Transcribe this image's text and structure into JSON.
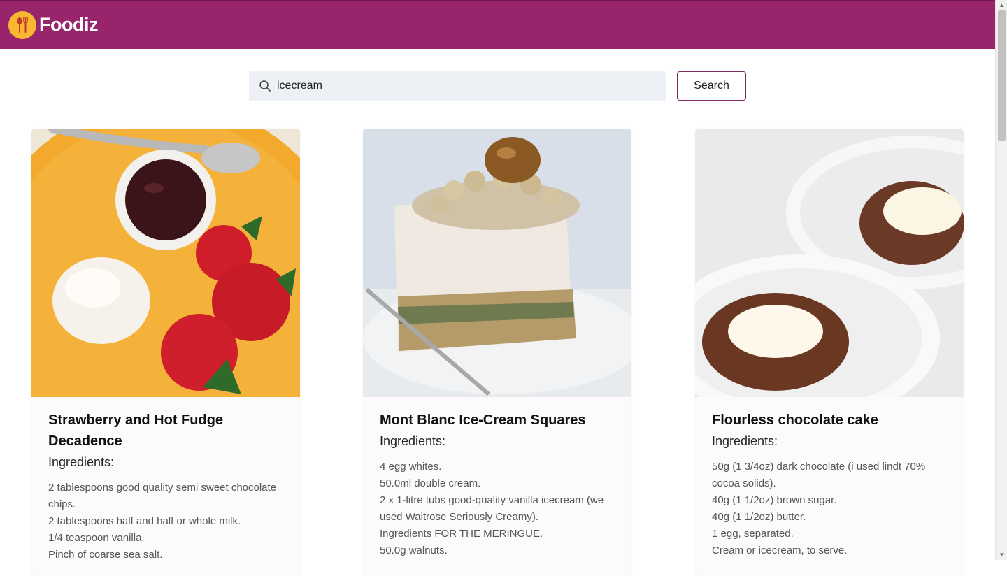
{
  "app": {
    "brand": "Foodiz",
    "colors": {
      "header": "#98256c",
      "logo": "#f7b731",
      "accent": "#7b2a5f"
    }
  },
  "search": {
    "value": "icecream",
    "button_label": "Search"
  },
  "recipes": [
    {
      "title": "Strawberry and Hot Fudge Decadence",
      "ingredients_label": "Ingredients:",
      "ingredients": [
        "2 tablespoons good quality semi sweet chocolate chips.",
        "2 tablespoons half and half or whole milk.",
        "1/4 teaspoon vanilla.",
        "Pinch of coarse sea salt."
      ]
    },
    {
      "title": "Mont Blanc Ice-Cream Squares",
      "ingredients_label": "Ingredients:",
      "ingredients": [
        "4 egg whites.",
        "50.0ml double cream.",
        "2 x 1-litre tubs good-quality vanilla icecream (we used Waitrose Seriously Creamy).",
        "Ingredients FOR THE MERINGUE.",
        "50.0g walnuts."
      ]
    },
    {
      "title": "Flourless chocolate cake",
      "ingredients_label": "Ingredients:",
      "ingredients": [
        "50g (1 3/4oz) dark chocolate (i used lindt 70% cocoa solids).",
        "40g (1 1/2oz) brown sugar.",
        "40g (1 1/2oz) butter.",
        "1 egg, separated.",
        "Cream or icecream, to serve."
      ]
    }
  ]
}
